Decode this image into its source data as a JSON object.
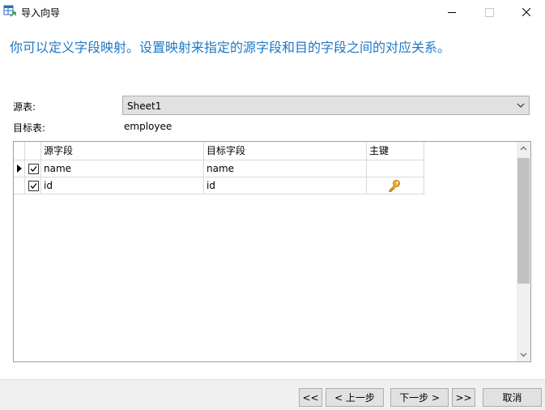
{
  "window": {
    "title": "导入向导",
    "icon": "table-import-icon"
  },
  "headline": "你可以定义字段映射。设置映射来指定的源字段和目的字段之间的对应关系。",
  "source_table": {
    "label": "源表:",
    "value": "Sheet1"
  },
  "target_table": {
    "label": "目标表:",
    "value": "employee"
  },
  "grid": {
    "columns": [
      "源字段",
      "目标字段",
      "主键"
    ],
    "rows": [
      {
        "checked": true,
        "source": "name",
        "target": "name",
        "primary_key": false,
        "current": true
      },
      {
        "checked": true,
        "source": "id",
        "target": "id",
        "primary_key": true,
        "current": false
      }
    ]
  },
  "buttons": {
    "first": "<<",
    "prev": "< 上一步",
    "next": "下一步 >",
    "last": ">>",
    "cancel": "取消"
  },
  "colors": {
    "headline": "#1f77c5",
    "key": "#e2a31a",
    "button_bg": "#e1e1e1"
  }
}
